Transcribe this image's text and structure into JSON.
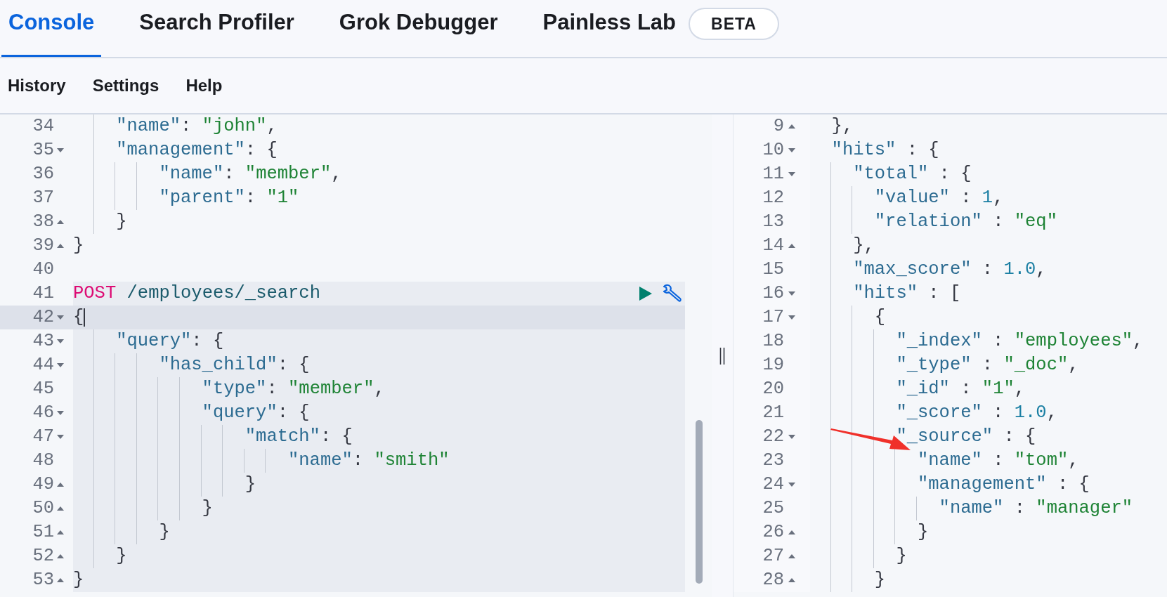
{
  "tabs": [
    {
      "label": "Console",
      "selected": true
    },
    {
      "label": "Search Profiler",
      "selected": false
    },
    {
      "label": "Grok Debugger",
      "selected": false
    },
    {
      "label": "Painless Lab",
      "selected": false,
      "badge": "BETA"
    }
  ],
  "toolbar": [
    "History",
    "Settings",
    "Help"
  ],
  "editor": {
    "lines": [
      {
        "kind": "code",
        "number": "34",
        "text": "    \"name\": \"john\",",
        "active": false
      },
      {
        "kind": "code",
        "number": "35",
        "text": "    \"management\": {",
        "fold_start": true,
        "active": false
      },
      {
        "kind": "code",
        "number": "36",
        "text": "        \"name\": \"member\",",
        "active": false
      },
      {
        "kind": "code",
        "number": "37",
        "text": "        \"parent\": \"1\"",
        "active": false
      },
      {
        "kind": "code",
        "number": "38",
        "text": "    }",
        "fold_start": false,
        "active": false
      },
      {
        "kind": "code",
        "number": "39",
        "text": "}",
        "fold_start": false,
        "active": false
      },
      {
        "kind": "blank",
        "number": "40",
        "active": false
      },
      {
        "kind": "request",
        "number": "41",
        "method": "POST",
        "path": "/employees/_search",
        "active": false
      },
      {
        "kind": "code",
        "number": "42",
        "text": "{",
        "fold_start": true,
        "active": true
      },
      {
        "kind": "code",
        "number": "43",
        "text": "    \"query\": {",
        "fold_start": true,
        "active": false
      },
      {
        "kind": "code",
        "number": "44",
        "text": "        \"has_child\": {",
        "fold_start": true,
        "active": false
      },
      {
        "kind": "code",
        "number": "45",
        "text": "            \"type\": \"member\",",
        "active": false
      },
      {
        "kind": "code",
        "number": "46",
        "text": "            \"query\": {",
        "fold_start": true,
        "active": false
      },
      {
        "kind": "code",
        "number": "47",
        "text": "                \"match\": {",
        "fold_start": true,
        "active": false
      },
      {
        "kind": "code",
        "number": "48",
        "text": "                    \"name\": \"smith\"",
        "active": false
      },
      {
        "kind": "code",
        "number": "49",
        "text": "                }",
        "fold_start": false,
        "active": false
      },
      {
        "kind": "code",
        "number": "50",
        "text": "            }",
        "fold_start": false,
        "active": false
      },
      {
        "kind": "code",
        "number": "51",
        "text": "        }",
        "fold_start": false,
        "active": false
      },
      {
        "kind": "code",
        "number": "52",
        "text": "    }",
        "fold_start": false,
        "active": false
      },
      {
        "kind": "code",
        "number": "53",
        "text": "}",
        "fold_start": false,
        "active": false
      }
    ]
  },
  "output": {
    "lines": [
      {
        "number": "9",
        "text": "  },",
        "fold_start": false
      },
      {
        "number": "10",
        "text": "  \"hits\" : {",
        "fold_start": true
      },
      {
        "number": "11",
        "text": "    \"total\" : {",
        "fold_start": true
      },
      {
        "number": "12",
        "text": "      \"value\" : 1,"
      },
      {
        "number": "13",
        "text": "      \"relation\" : \"eq\""
      },
      {
        "number": "14",
        "text": "    },",
        "fold_start": false
      },
      {
        "number": "15",
        "text": "    \"max_score\" : 1.0,"
      },
      {
        "number": "16",
        "text": "    \"hits\" : [",
        "fold_start": true
      },
      {
        "number": "17",
        "text": "      {",
        "fold_start": true
      },
      {
        "number": "18",
        "text": "        \"_index\" : \"employees\","
      },
      {
        "number": "19",
        "text": "        \"_type\" : \"_doc\","
      },
      {
        "number": "20",
        "text": "        \"_id\" : \"1\","
      },
      {
        "number": "21",
        "text": "        \"_score\" : 1.0,"
      },
      {
        "number": "22",
        "text": "        \"_source\" : {",
        "fold_start": true
      },
      {
        "number": "23",
        "text": "          \"name\" : \"tom\","
      },
      {
        "number": "24",
        "text": "          \"management\" : {",
        "fold_start": true
      },
      {
        "number": "25",
        "text": "            \"name\" : \"manager\""
      },
      {
        "number": "26",
        "text": "          }",
        "fold_start": false
      },
      {
        "number": "27",
        "text": "        }",
        "fold_start": false
      },
      {
        "number": "28",
        "text": "      }",
        "fold_start": false
      }
    ]
  }
}
